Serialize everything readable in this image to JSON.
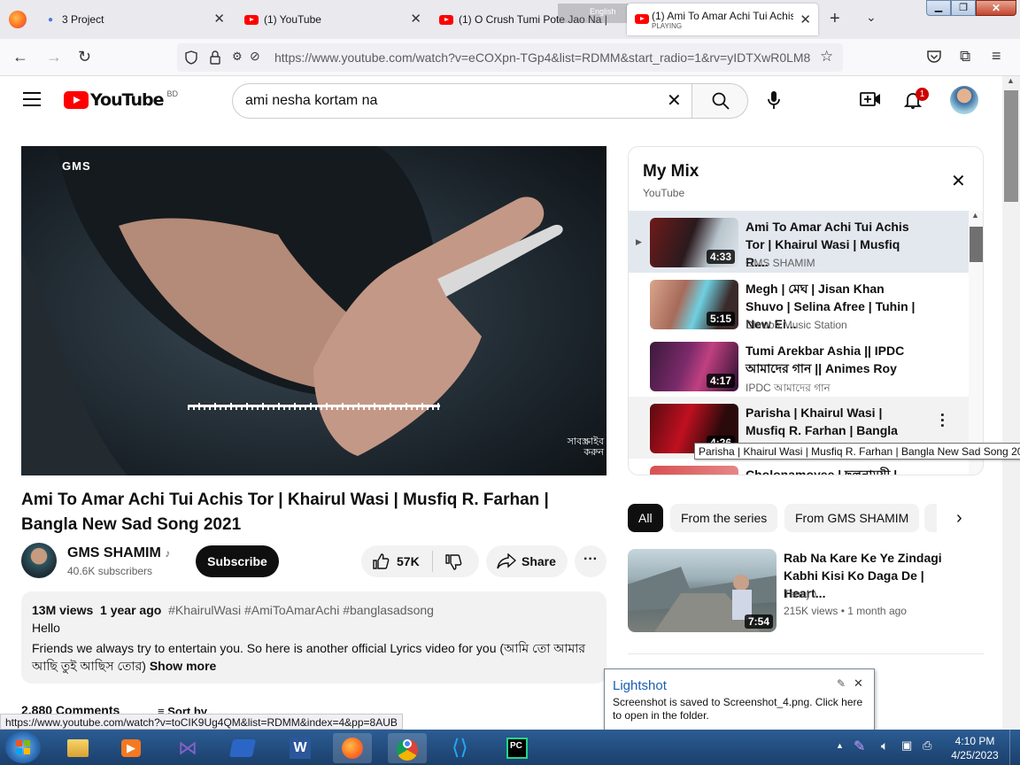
{
  "browser": {
    "tabs": [
      {
        "label": "3 Project"
      },
      {
        "label": "(1) YouTube"
      },
      {
        "label": "(1) O Crush Tumi Pote Jao Na |"
      },
      {
        "label": "(1) Ami To Amar Achi Tui Achis",
        "sublabel": "PLAYING"
      }
    ],
    "overlay_text": "English",
    "url": "https://www.youtube.com/watch?v=eCOXpn-TGp4&list=RDMM&start_radio=1&rv=yIDTXwR0LM8"
  },
  "youtube": {
    "logo_text": "YouTube",
    "region": "BD",
    "search_value": "ami nesha kortam na",
    "notification_count": "1"
  },
  "player": {
    "watermark_top": "GMS",
    "watermark_bottom": "সাবস্ক্রাইব করুন"
  },
  "video": {
    "title": "Ami To Amar Achi Tui Achis Tor | Khairul Wasi | Musfiq R. Farhan | Bangla New Sad Song 2021",
    "channel": "GMS SHAMIM",
    "subscribers": "40.6K subscribers",
    "subscribe_label": "Subscribe",
    "likes": "57K",
    "share_label": "Share",
    "views": "13M views",
    "age": "1 year ago",
    "hashtags": "#KhairulWasi #AmiToAmarAchi #banglasadsong",
    "desc_line1": "Hello",
    "desc_line2": "Friends we always try to entertain you. So here is another official Lyrics video for you (আমি তো আমার",
    "desc_line3": "আছি তুই আছিস তোর)",
    "show_more": "Show more",
    "comments_partial": "2,880 Comments",
    "sort_by": "Sort by"
  },
  "mix": {
    "title": "My Mix",
    "subtitle": "YouTube",
    "items": [
      {
        "title": "Ami To Amar Achi Tui Achis Tor | Khairul Wasi | Musfiq R....",
        "channel": "GMS SHAMIM",
        "duration": "4:33"
      },
      {
        "title": "Megh | মেঘ | Jisan Khan Shuvo | Selina Afree | Tuhin | New Ei...",
        "channel": "Dhruba Music Station",
        "duration": "5:15"
      },
      {
        "title": "Tumi Arekbar Ashia || IPDC আমাদের গান || Animes Roy",
        "channel": "IPDC আমাদের গান",
        "duration": "4:17"
      },
      {
        "title": "Parisha | Khairul Wasi | Musfiq R. Farhan | Bangla New Sad...",
        "channel": "",
        "duration": "4:26"
      },
      {
        "title": "Cholonamoyee | ছলনাময়ী |",
        "channel": "",
        "duration": ""
      }
    ],
    "tooltip": "Parisha | Khairul Wasi | Musfiq R. Farhan | Bangla New Sad Song 2022"
  },
  "chips": [
    "All",
    "From the series",
    "From GMS SHAMIM"
  ],
  "recommended": {
    "title": "Rab Na Kare Ke Ye Zindagi Kabhi Kisi Ko Daga De | Heart...",
    "channel": "Tanuj",
    "meta": "215K views",
    "age": "1 month ago",
    "duration": "7:54"
  },
  "status_url": "https://www.youtube.com/watch?v=toCIK9Ug4QM&list=RDMM&index=4&pp=8AUB",
  "notification": {
    "title": "Lightshot",
    "body": "Screenshot is saved to Screenshot_4.png. Click here to open in the folder."
  },
  "clock": {
    "time": "4:10 PM",
    "date": "4/25/2023"
  },
  "colors": {
    "yt_red": "#ff0000",
    "subscribe_bg": "#0f0f0f",
    "taskbar": "#1b3f6b"
  }
}
